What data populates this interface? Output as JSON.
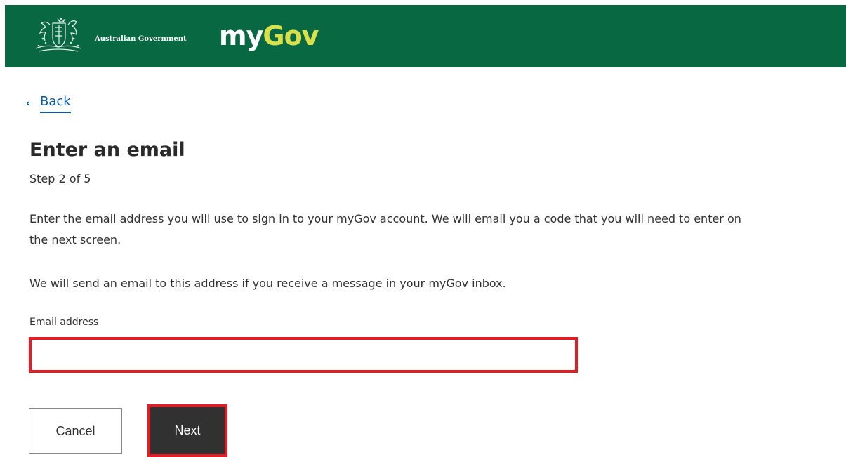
{
  "header": {
    "government_name": "Australian Government",
    "logo": {
      "part1": "my",
      "part2": "Gov"
    },
    "crest_icon": "coat-of-arms-icon"
  },
  "nav": {
    "back_label": "Back",
    "back_icon": "chevron-left-icon"
  },
  "page": {
    "title": "Enter an email",
    "step": "Step 2 of 5",
    "paragraph1": "Enter the email address you will use to sign in to your myGov account. We will email you a code that you will need to enter on the next screen.",
    "paragraph2": "We will send an email to this address if you receive a message in your myGov inbox."
  },
  "form": {
    "email_label": "Email address",
    "email_value": "",
    "email_placeholder": ""
  },
  "buttons": {
    "cancel_label": "Cancel",
    "next_label": "Next"
  },
  "colors": {
    "header_bg": "#076841",
    "logo_accent": "#d8e04c",
    "link": "#0b5a9d",
    "highlight": "#e41c24",
    "primary_button": "#313131"
  }
}
